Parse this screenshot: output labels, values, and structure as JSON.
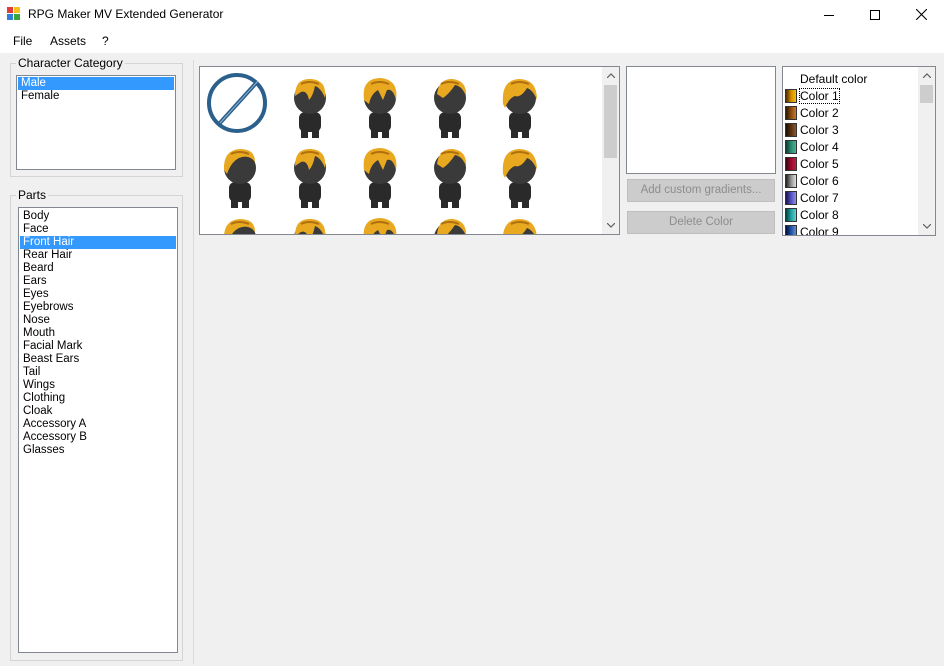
{
  "window": {
    "title": "RPG Maker MV Extended Generator",
    "minimize_icon": "minimize-icon",
    "maximize_icon": "maximize-icon",
    "close_icon": "close-icon"
  },
  "menu": {
    "items": [
      "File",
      "Assets",
      "?"
    ]
  },
  "category": {
    "label": "Character Category",
    "items": [
      "Male",
      "Female"
    ],
    "selected": "Male"
  },
  "parts": {
    "label": "Parts",
    "items": [
      "Body",
      "Face",
      "Front Hair",
      "Rear Hair",
      "Beard",
      "Ears",
      "Eyes",
      "Eyebrows",
      "Nose",
      "Mouth",
      "Facial Mark",
      "Beast Ears",
      "Tail",
      "Wings",
      "Clothing",
      "Cloak",
      "Accessory A",
      "Accessory B",
      "Glasses"
    ],
    "selected": "Front Hair"
  },
  "buttons": {
    "add_gradients": "Add custom gradients...",
    "delete_color": "Delete Color"
  },
  "colors": {
    "items": [
      {
        "label": "Default color",
        "gradient": ""
      },
      {
        "label": "Color 1",
        "gradient": "linear-gradient(90deg,#4a2a00,#d08a00,#f5c000)"
      },
      {
        "label": "Color 2",
        "gradient": "linear-gradient(90deg,#2a1500,#8a4a10,#c67a2a)"
      },
      {
        "label": "Color 3",
        "gradient": "linear-gradient(90deg,#1a0e05,#5a3010,#8a5a30)"
      },
      {
        "label": "Color 4",
        "gradient": "linear-gradient(90deg,#0a3a30,#2a8a70,#50b090)"
      },
      {
        "label": "Color 5",
        "gradient": "linear-gradient(90deg,#3a0010,#9a0a30,#c02040)"
      },
      {
        "label": "Color 6",
        "gradient": "linear-gradient(90deg,#202020,#909090,#e0e0e0)"
      },
      {
        "label": "Color 7",
        "gradient": "linear-gradient(90deg,#1a1050,#5050c0,#9090e0)"
      },
      {
        "label": "Color 8",
        "gradient": "linear-gradient(90deg,#004040,#20a0a0,#60d0d0)"
      },
      {
        "label": "Color 9",
        "gradient": "linear-gradient(90deg,#001040,#2050a0,#6090d0)"
      }
    ],
    "selected": "Color 1"
  },
  "thumbnails": {
    "icons": [
      "none-icon",
      "front-hair-thumbnail"
    ],
    "hair_color": "#e8a820",
    "hair_shade": "#b07010",
    "body_color": "#2a2a2a"
  }
}
